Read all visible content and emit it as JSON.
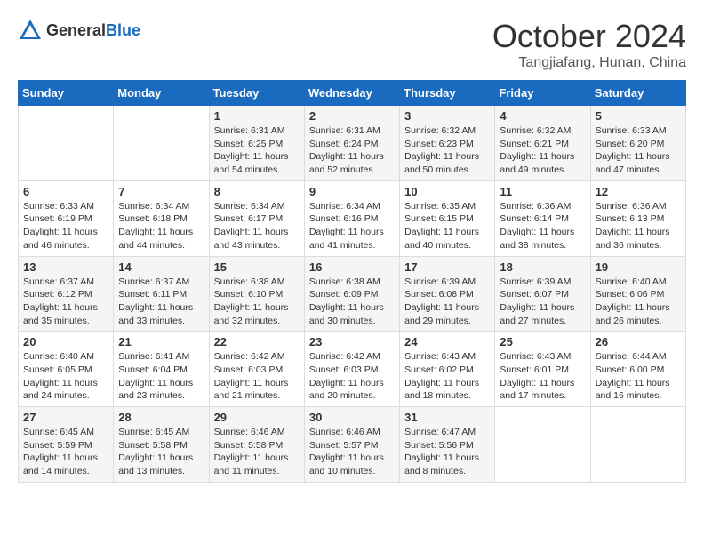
{
  "header": {
    "logo_general": "General",
    "logo_blue": "Blue",
    "month": "October 2024",
    "location": "Tangjiafang, Hunan, China"
  },
  "days_of_week": [
    "Sunday",
    "Monday",
    "Tuesday",
    "Wednesday",
    "Thursday",
    "Friday",
    "Saturday"
  ],
  "weeks": [
    [
      {
        "day": "",
        "info": ""
      },
      {
        "day": "",
        "info": ""
      },
      {
        "day": "1",
        "info": "Sunrise: 6:31 AM\nSunset: 6:25 PM\nDaylight: 11 hours and 54 minutes."
      },
      {
        "day": "2",
        "info": "Sunrise: 6:31 AM\nSunset: 6:24 PM\nDaylight: 11 hours and 52 minutes."
      },
      {
        "day": "3",
        "info": "Sunrise: 6:32 AM\nSunset: 6:23 PM\nDaylight: 11 hours and 50 minutes."
      },
      {
        "day": "4",
        "info": "Sunrise: 6:32 AM\nSunset: 6:21 PM\nDaylight: 11 hours and 49 minutes."
      },
      {
        "day": "5",
        "info": "Sunrise: 6:33 AM\nSunset: 6:20 PM\nDaylight: 11 hours and 47 minutes."
      }
    ],
    [
      {
        "day": "6",
        "info": "Sunrise: 6:33 AM\nSunset: 6:19 PM\nDaylight: 11 hours and 46 minutes."
      },
      {
        "day": "7",
        "info": "Sunrise: 6:34 AM\nSunset: 6:18 PM\nDaylight: 11 hours and 44 minutes."
      },
      {
        "day": "8",
        "info": "Sunrise: 6:34 AM\nSunset: 6:17 PM\nDaylight: 11 hours and 43 minutes."
      },
      {
        "day": "9",
        "info": "Sunrise: 6:34 AM\nSunset: 6:16 PM\nDaylight: 11 hours and 41 minutes."
      },
      {
        "day": "10",
        "info": "Sunrise: 6:35 AM\nSunset: 6:15 PM\nDaylight: 11 hours and 40 minutes."
      },
      {
        "day": "11",
        "info": "Sunrise: 6:36 AM\nSunset: 6:14 PM\nDaylight: 11 hours and 38 minutes."
      },
      {
        "day": "12",
        "info": "Sunrise: 6:36 AM\nSunset: 6:13 PM\nDaylight: 11 hours and 36 minutes."
      }
    ],
    [
      {
        "day": "13",
        "info": "Sunrise: 6:37 AM\nSunset: 6:12 PM\nDaylight: 11 hours and 35 minutes."
      },
      {
        "day": "14",
        "info": "Sunrise: 6:37 AM\nSunset: 6:11 PM\nDaylight: 11 hours and 33 minutes."
      },
      {
        "day": "15",
        "info": "Sunrise: 6:38 AM\nSunset: 6:10 PM\nDaylight: 11 hours and 32 minutes."
      },
      {
        "day": "16",
        "info": "Sunrise: 6:38 AM\nSunset: 6:09 PM\nDaylight: 11 hours and 30 minutes."
      },
      {
        "day": "17",
        "info": "Sunrise: 6:39 AM\nSunset: 6:08 PM\nDaylight: 11 hours and 29 minutes."
      },
      {
        "day": "18",
        "info": "Sunrise: 6:39 AM\nSunset: 6:07 PM\nDaylight: 11 hours and 27 minutes."
      },
      {
        "day": "19",
        "info": "Sunrise: 6:40 AM\nSunset: 6:06 PM\nDaylight: 11 hours and 26 minutes."
      }
    ],
    [
      {
        "day": "20",
        "info": "Sunrise: 6:40 AM\nSunset: 6:05 PM\nDaylight: 11 hours and 24 minutes."
      },
      {
        "day": "21",
        "info": "Sunrise: 6:41 AM\nSunset: 6:04 PM\nDaylight: 11 hours and 23 minutes."
      },
      {
        "day": "22",
        "info": "Sunrise: 6:42 AM\nSunset: 6:03 PM\nDaylight: 11 hours and 21 minutes."
      },
      {
        "day": "23",
        "info": "Sunrise: 6:42 AM\nSunset: 6:03 PM\nDaylight: 11 hours and 20 minutes."
      },
      {
        "day": "24",
        "info": "Sunrise: 6:43 AM\nSunset: 6:02 PM\nDaylight: 11 hours and 18 minutes."
      },
      {
        "day": "25",
        "info": "Sunrise: 6:43 AM\nSunset: 6:01 PM\nDaylight: 11 hours and 17 minutes."
      },
      {
        "day": "26",
        "info": "Sunrise: 6:44 AM\nSunset: 6:00 PM\nDaylight: 11 hours and 16 minutes."
      }
    ],
    [
      {
        "day": "27",
        "info": "Sunrise: 6:45 AM\nSunset: 5:59 PM\nDaylight: 11 hours and 14 minutes."
      },
      {
        "day": "28",
        "info": "Sunrise: 6:45 AM\nSunset: 5:58 PM\nDaylight: 11 hours and 13 minutes."
      },
      {
        "day": "29",
        "info": "Sunrise: 6:46 AM\nSunset: 5:58 PM\nDaylight: 11 hours and 11 minutes."
      },
      {
        "day": "30",
        "info": "Sunrise: 6:46 AM\nSunset: 5:57 PM\nDaylight: 11 hours and 10 minutes."
      },
      {
        "day": "31",
        "info": "Sunrise: 6:47 AM\nSunset: 5:56 PM\nDaylight: 11 hours and 8 minutes."
      },
      {
        "day": "",
        "info": ""
      },
      {
        "day": "",
        "info": ""
      }
    ]
  ]
}
